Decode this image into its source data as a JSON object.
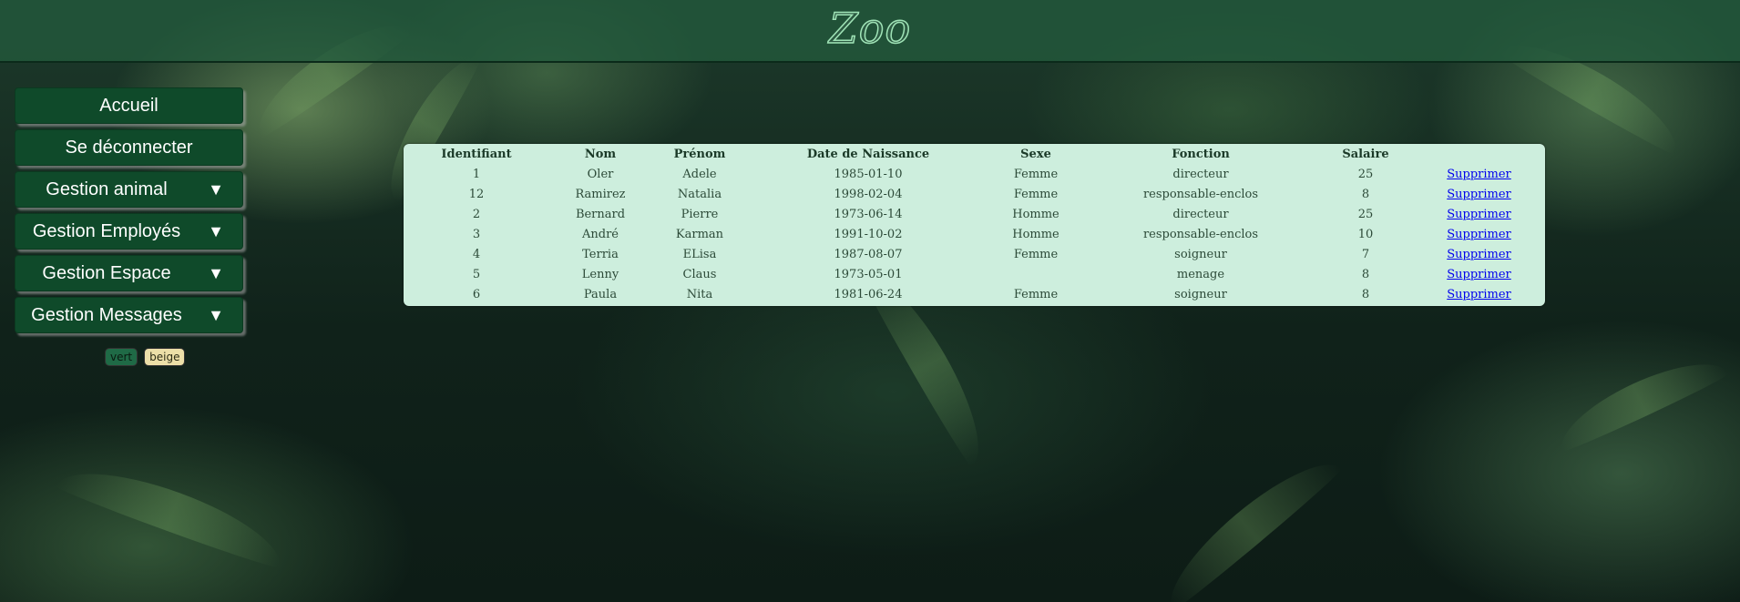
{
  "header": {
    "title": "Zoo"
  },
  "sidebar": {
    "items": [
      {
        "label": "Accueil",
        "dropdown": false
      },
      {
        "label": "Se déconnecter",
        "dropdown": false
      },
      {
        "label": "Gestion animal",
        "dropdown": true
      },
      {
        "label": "Gestion Employés",
        "dropdown": true
      },
      {
        "label": "Gestion Espace",
        "dropdown": true
      },
      {
        "label": "Gestion Messages",
        "dropdown": true
      }
    ],
    "dropdown_arrow": "▼"
  },
  "theme": {
    "vert_label": "vert",
    "beige_label": "beige"
  },
  "table": {
    "columns": [
      "Identifiant",
      "Nom",
      "Prénom",
      "Date de Naissance",
      "Sexe",
      "Fonction",
      "Salaire",
      ""
    ],
    "action_label": "Supprimer",
    "rows": [
      [
        "1",
        "Oler",
        "Adele",
        "1985-01-10",
        "Femme",
        "directeur",
        "25"
      ],
      [
        "12",
        "Ramirez",
        "Natalia",
        "1998-02-04",
        "Femme",
        "responsable-enclos",
        "8"
      ],
      [
        "2",
        "Bernard",
        "Pierre",
        "1973-06-14",
        "Homme",
        "directeur",
        "25"
      ],
      [
        "3",
        "André",
        "Karman",
        "1991-10-02",
        "Homme",
        "responsable-enclos",
        "10"
      ],
      [
        "4",
        "Terria",
        "ELisa",
        "1987-08-07",
        "Femme",
        "soigneur",
        "7"
      ],
      [
        "5",
        "Lenny",
        "Claus",
        "1973-05-01",
        "",
        "menage",
        "8"
      ],
      [
        "6",
        "Paula",
        "Nita",
        "1981-06-24",
        "Femme",
        "soigneur",
        "8"
      ]
    ]
  },
  "colors": {
    "header_bg": "#235a3c",
    "nav_bg": "#0f4a2a",
    "table_bg": "#cdeedd",
    "link": "#0000ee"
  }
}
